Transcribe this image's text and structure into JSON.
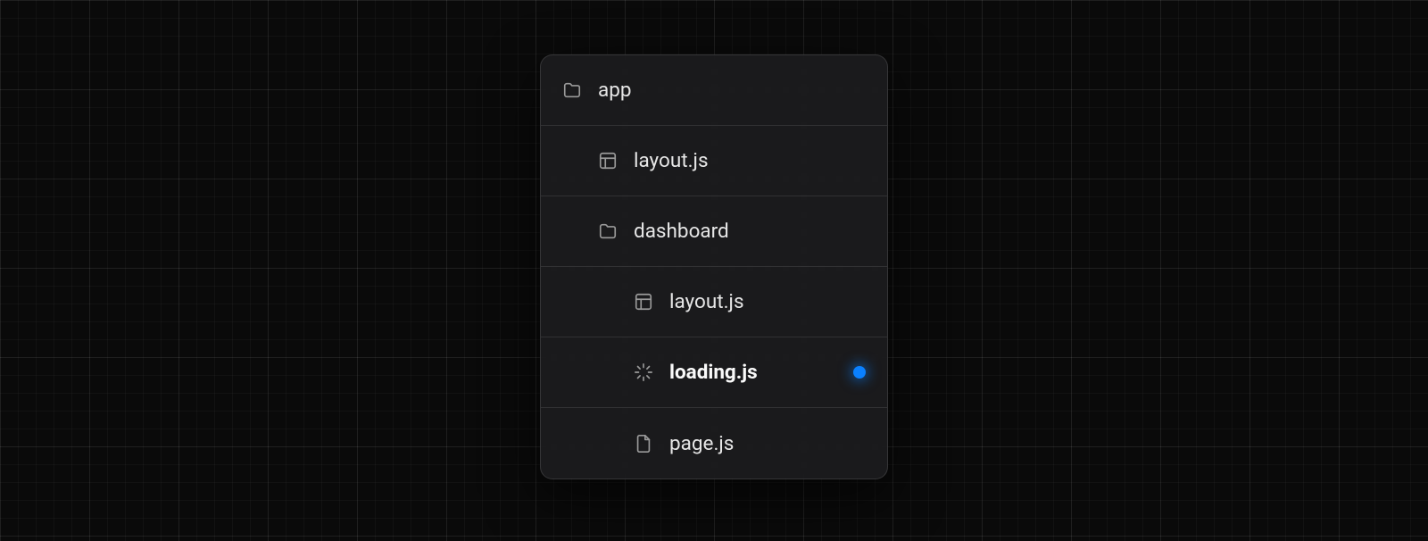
{
  "tree": {
    "items": [
      {
        "label": "app",
        "icon": "folder",
        "depth": 0,
        "active": false
      },
      {
        "label": "layout.js",
        "icon": "layout",
        "depth": 1,
        "active": false
      },
      {
        "label": "dashboard",
        "icon": "folder",
        "depth": 1,
        "active": false
      },
      {
        "label": "layout.js",
        "icon": "layout",
        "depth": 2,
        "active": false
      },
      {
        "label": "loading.js",
        "icon": "loading",
        "depth": 2,
        "active": true
      },
      {
        "label": "page.js",
        "icon": "file",
        "depth": 2,
        "active": false
      }
    ]
  },
  "colors": {
    "accent": "#0a80ff",
    "background": "#0a0a0a",
    "panel": "#1c1c1e",
    "text": "#e6e6e6",
    "muted": "#9a9a9a"
  }
}
